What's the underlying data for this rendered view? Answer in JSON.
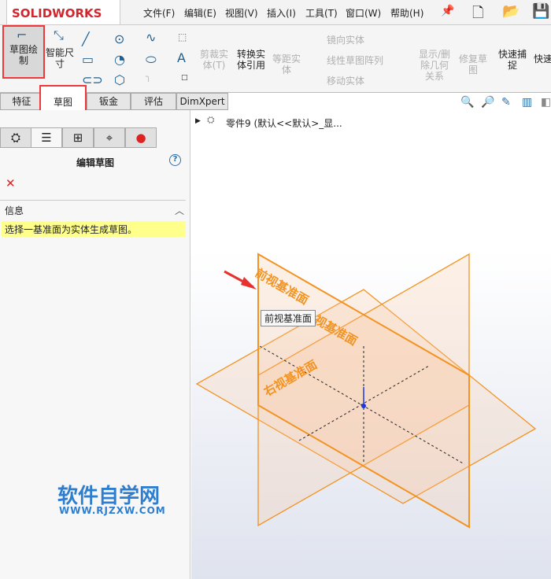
{
  "app": {
    "logo": "SOLIDWORKS"
  },
  "menu": [
    "文件(F)",
    "编辑(E)",
    "视图(V)",
    "插入(I)",
    "工具(T)",
    "窗口(W)",
    "帮助(H)"
  ],
  "ribbon": {
    "sketch": "草图绘制",
    "smart_dim": "智能尺寸",
    "trim": "剪裁实体(T)",
    "convert": "转换实体引用",
    "offset": "等距实体",
    "mirror": "镜向实体",
    "linear_pattern": "线性草图阵列",
    "move": "移动实体",
    "show_rel": "显示/删除几何关系",
    "repair": "修复草图",
    "quick_snap": "快速捕捉",
    "quick_view": "快速视图"
  },
  "tabs": [
    "特征",
    "草图",
    "钣金",
    "评估",
    "DimXpert"
  ],
  "panel": {
    "title": "编辑草图",
    "info_header": "信息",
    "info_text": "选择一基准面为实体生成草图。"
  },
  "tree": {
    "root": "零件9  (默认<<默认>_显..."
  },
  "viewport": {
    "planes": [
      "前视基准面",
      "上视基准面",
      "右视基准面"
    ],
    "tooltip": "前视基准面",
    "plane_color": "#f39322"
  },
  "watermark": {
    "title": "软件自学网",
    "url": "WWW.RJZXW.COM"
  }
}
